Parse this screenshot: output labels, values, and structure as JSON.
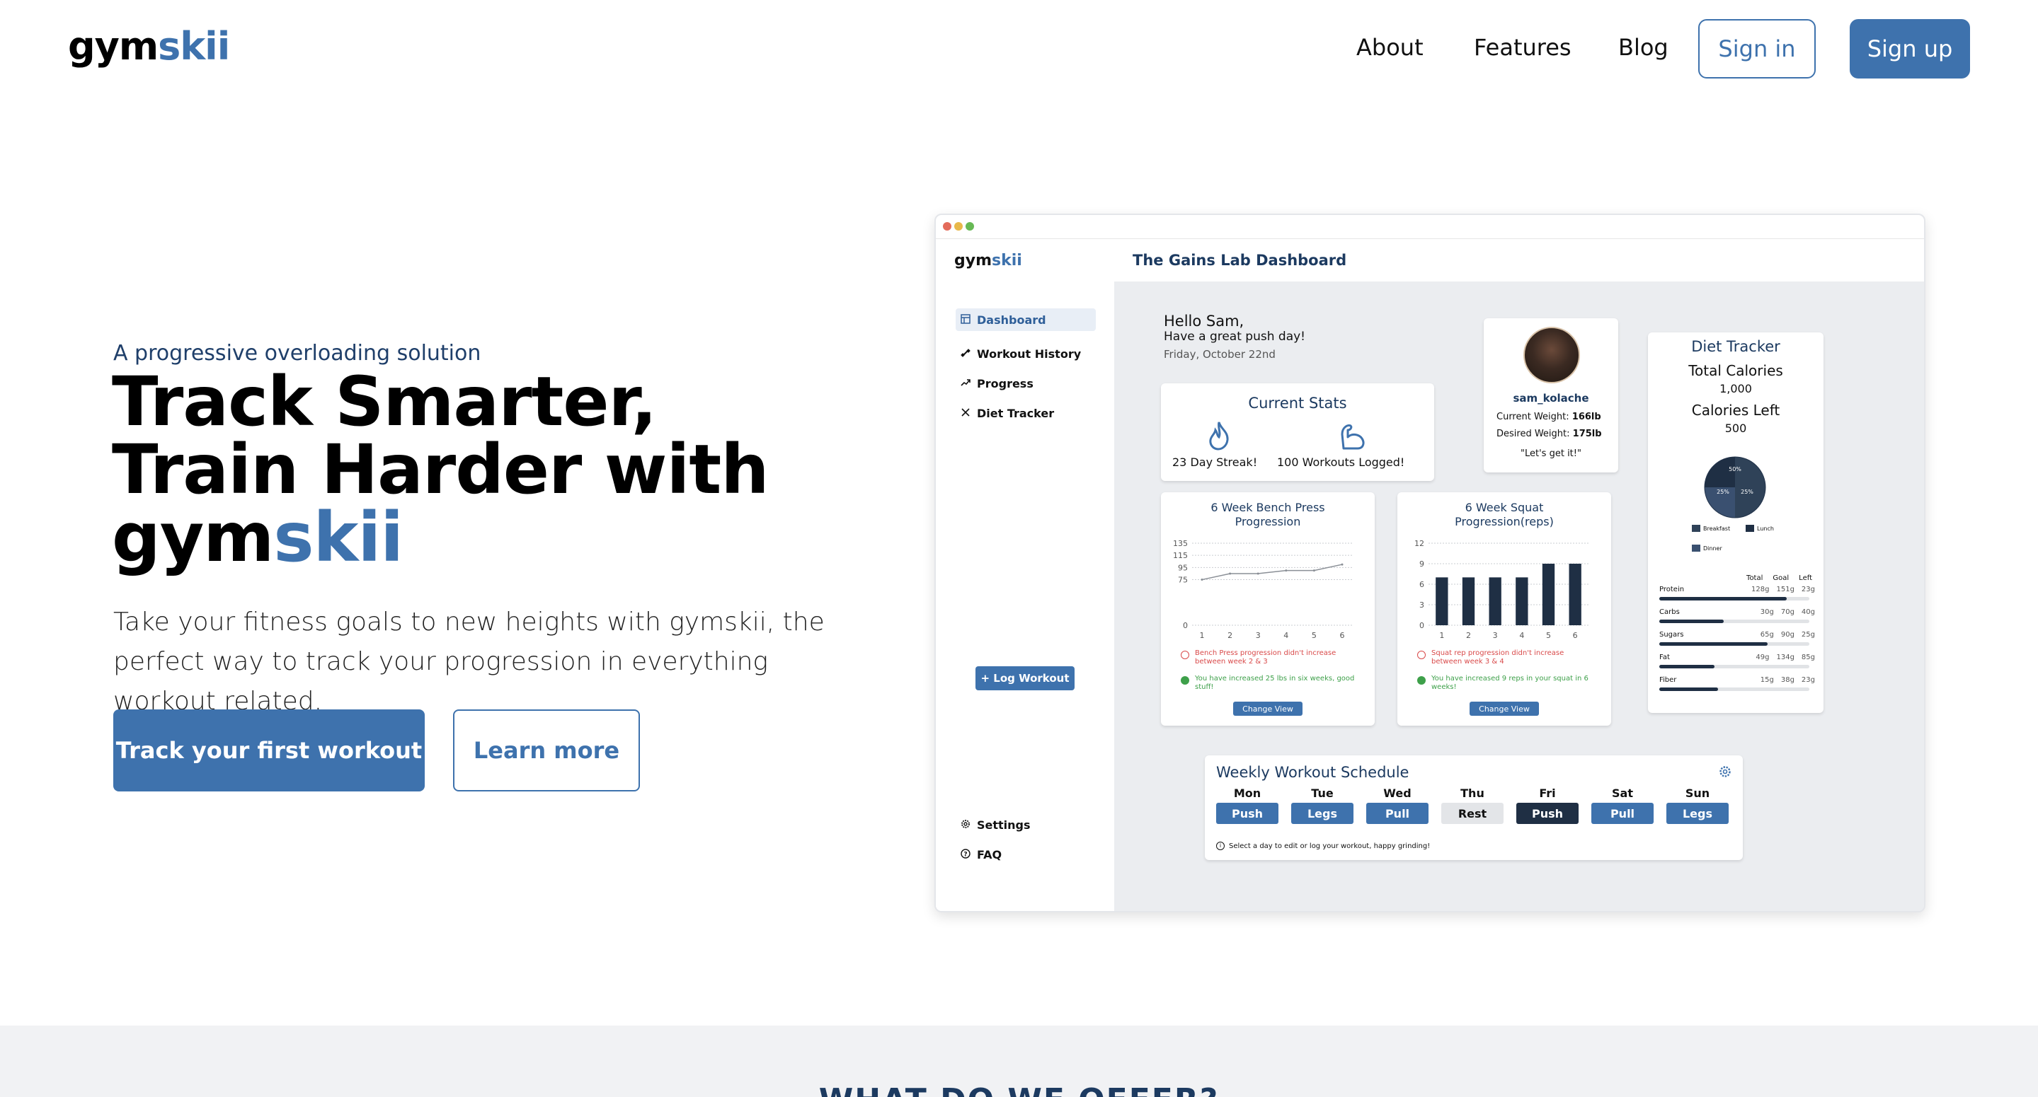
{
  "brand": {
    "prefix": "gym",
    "accent": "skii",
    "accent_color": "#3e72ad"
  },
  "nav": {
    "links": [
      "About",
      "Features",
      "Blog"
    ],
    "sign_in": "Sign in",
    "sign_up": "Sign up"
  },
  "hero": {
    "tagline": "A progressive overloading solution",
    "headline_line1": "Track Smarter,",
    "headline_line2": "Train Harder with",
    "headline_brand_prefix": "gym",
    "headline_brand_accent": "skii",
    "subtitle": "Take your fitness goals to new heights with gymskii, the perfect way to track your progression in everything workout related.",
    "cta_primary": "Track your first workout",
    "cta_secondary": "Learn more"
  },
  "dashboard": {
    "title": "The Gains Lab Dashboard",
    "sidebar": {
      "items": [
        {
          "label": "Dashboard",
          "icon": "grid-icon"
        },
        {
          "label": "Workout History",
          "icon": "dumbbell-icon"
        },
        {
          "label": "Progress",
          "icon": "trend-icon"
        },
        {
          "label": "Diet Tracker",
          "icon": "utensils-icon"
        }
      ],
      "log_button": "+ Log Workout",
      "bottom": [
        {
          "label": "Settings",
          "icon": "gear-icon"
        },
        {
          "label": "FAQ",
          "icon": "help-icon"
        }
      ]
    },
    "greeting": {
      "hello": "Hello Sam,",
      "message": "Have a great push day!",
      "date": "Friday, October 22nd"
    },
    "current_stats": {
      "title": "Current Stats",
      "streak": "23 Day Streak!",
      "workouts": "100 Workouts Logged!"
    },
    "profile": {
      "username": "sam_kolache",
      "current_weight_label": "Current Weight:",
      "current_weight": "166lb",
      "desired_weight_label": "Desired Weight:",
      "desired_weight": "175lb",
      "quote": "\"Let's get it!\""
    },
    "bench_chart": {
      "title_line1": "6 Week Bench Press",
      "title_line2": "Progression",
      "warning": "Bench Press progression didn't increase between week 2 & 3",
      "success": "You have increased 25 lbs in six weeks, good stuff!",
      "button": "Change View"
    },
    "squat_chart": {
      "title_line1": "6 Week Squat",
      "title_line2": "Progression(reps)",
      "warning": "Squat rep progression didn't increase between week 3 & 4",
      "success": "You have increased 9 reps in your squat in 6 weeks!",
      "button": "Change View"
    },
    "diet": {
      "title": "Diet Tracker",
      "total_label": "Total Calories",
      "total_value": "1,000",
      "left_label": "Calories Left",
      "left_value": "500",
      "pie": [
        {
          "label": "Breakfast",
          "percent": "50%",
          "value": 50,
          "color": "#2f4258"
        },
        {
          "label": "Lunch",
          "percent": "25%",
          "value": 25,
          "color": "#1f2f44"
        },
        {
          "label": "Dinner",
          "percent": "25%",
          "value": 25,
          "color": "#3a5070"
        }
      ],
      "columns": [
        "Total",
        "Goal",
        "Left"
      ],
      "macros": [
        {
          "name": "Protein",
          "total": "128g",
          "goal": "151g",
          "left": "23g",
          "fill": 0.85
        },
        {
          "name": "Carbs",
          "total": "30g",
          "goal": "70g",
          "left": "40g",
          "fill": 0.43
        },
        {
          "name": "Sugars",
          "total": "65g",
          "goal": "90g",
          "left": "25g",
          "fill": 0.72
        },
        {
          "name": "Fat",
          "total": "49g",
          "goal": "134g",
          "left": "85g",
          "fill": 0.37
        },
        {
          "name": "Fiber",
          "total": "15g",
          "goal": "38g",
          "left": "23g",
          "fill": 0.39
        }
      ]
    },
    "schedule": {
      "title": "Weekly Workout Schedule",
      "hint": "Select a day to edit or log your workout, happy grinding!",
      "days": [
        {
          "day": "Mon",
          "workout": "Push",
          "style": "normal"
        },
        {
          "day": "Tue",
          "workout": "Legs",
          "style": "normal"
        },
        {
          "day": "Wed",
          "workout": "Pull",
          "style": "normal"
        },
        {
          "day": "Thu",
          "workout": "Rest",
          "style": "rest"
        },
        {
          "day": "Fri",
          "workout": "Push",
          "style": "today"
        },
        {
          "day": "Sat",
          "workout": "Pull",
          "style": "normal"
        },
        {
          "day": "Sun",
          "workout": "Legs",
          "style": "normal"
        }
      ]
    }
  },
  "chart_data": [
    {
      "type": "line",
      "title": "6 Week Bench Press Progression",
      "x": [
        1,
        2,
        3,
        4,
        5,
        6
      ],
      "series": [
        {
          "values": [
            75,
            85,
            85,
            90,
            90,
            100
          ]
        }
      ],
      "ylim": [
        0,
        135
      ],
      "yticks": [
        0,
        75,
        95,
        115,
        135
      ],
      "grid": true
    },
    {
      "type": "bar",
      "title": "6 Week Squat Progression(reps)",
      "categories": [
        "1",
        "2",
        "3",
        "4",
        "5",
        "6"
      ],
      "values": [
        7,
        7,
        7,
        7,
        9,
        9
      ],
      "ylim": [
        0,
        12
      ],
      "yticks": [
        0,
        3,
        6,
        9,
        12
      ],
      "grid": true
    }
  ],
  "offer_heading": "WHAT DO WE OFFER?"
}
